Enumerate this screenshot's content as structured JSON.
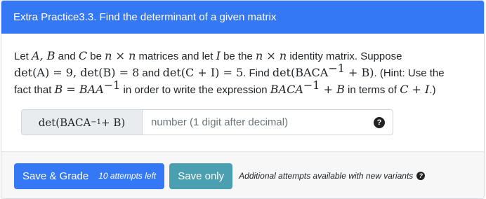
{
  "header": {
    "title": "Extra Practice3.3. Find the determinant of a given matrix"
  },
  "problem": {
    "p01": "Let ",
    "p02": "A, B",
    "p03": " and ",
    "p04": "C",
    "p05": " be ",
    "p06": "n",
    "p07": " × ",
    "p08": "n",
    "p09": " matrices and let ",
    "p10": "I",
    "p11": " be the ",
    "p12": "n",
    "p13": " × ",
    "p14": "n",
    "p15": " identity matrix. Suppose",
    "p16": "det(A) = 9, det(B) = 8",
    "p17": " and ",
    "p18": "det(C + I) = 5",
    "p19": ". Find ",
    "p20": "det(BACA",
    "p21": "−1",
    "p22": " + B)",
    "p23": ". (Hint: Use the",
    "p24": "fact that ",
    "p25": "B = BAA",
    "p26": "−1",
    "p27": " in order to write the expression ",
    "p28": "BACA",
    "p29": "−1",
    "p30": " + B",
    "p31": " in terms of ",
    "p32": "C + I",
    "p33": ".)"
  },
  "answer": {
    "label_main": "det(BACA",
    "label_sup": "−1",
    "label_end": " + B)",
    "value": "",
    "placeholder": "number (1 digit after decimal)",
    "help_icon": "?"
  },
  "footer": {
    "save_grade_label": "Save & Grade",
    "attempts_left": "10 attempts left",
    "save_only_label": "Save only",
    "note": "Additional attempts available with new variants",
    "note_icon": "?"
  }
}
